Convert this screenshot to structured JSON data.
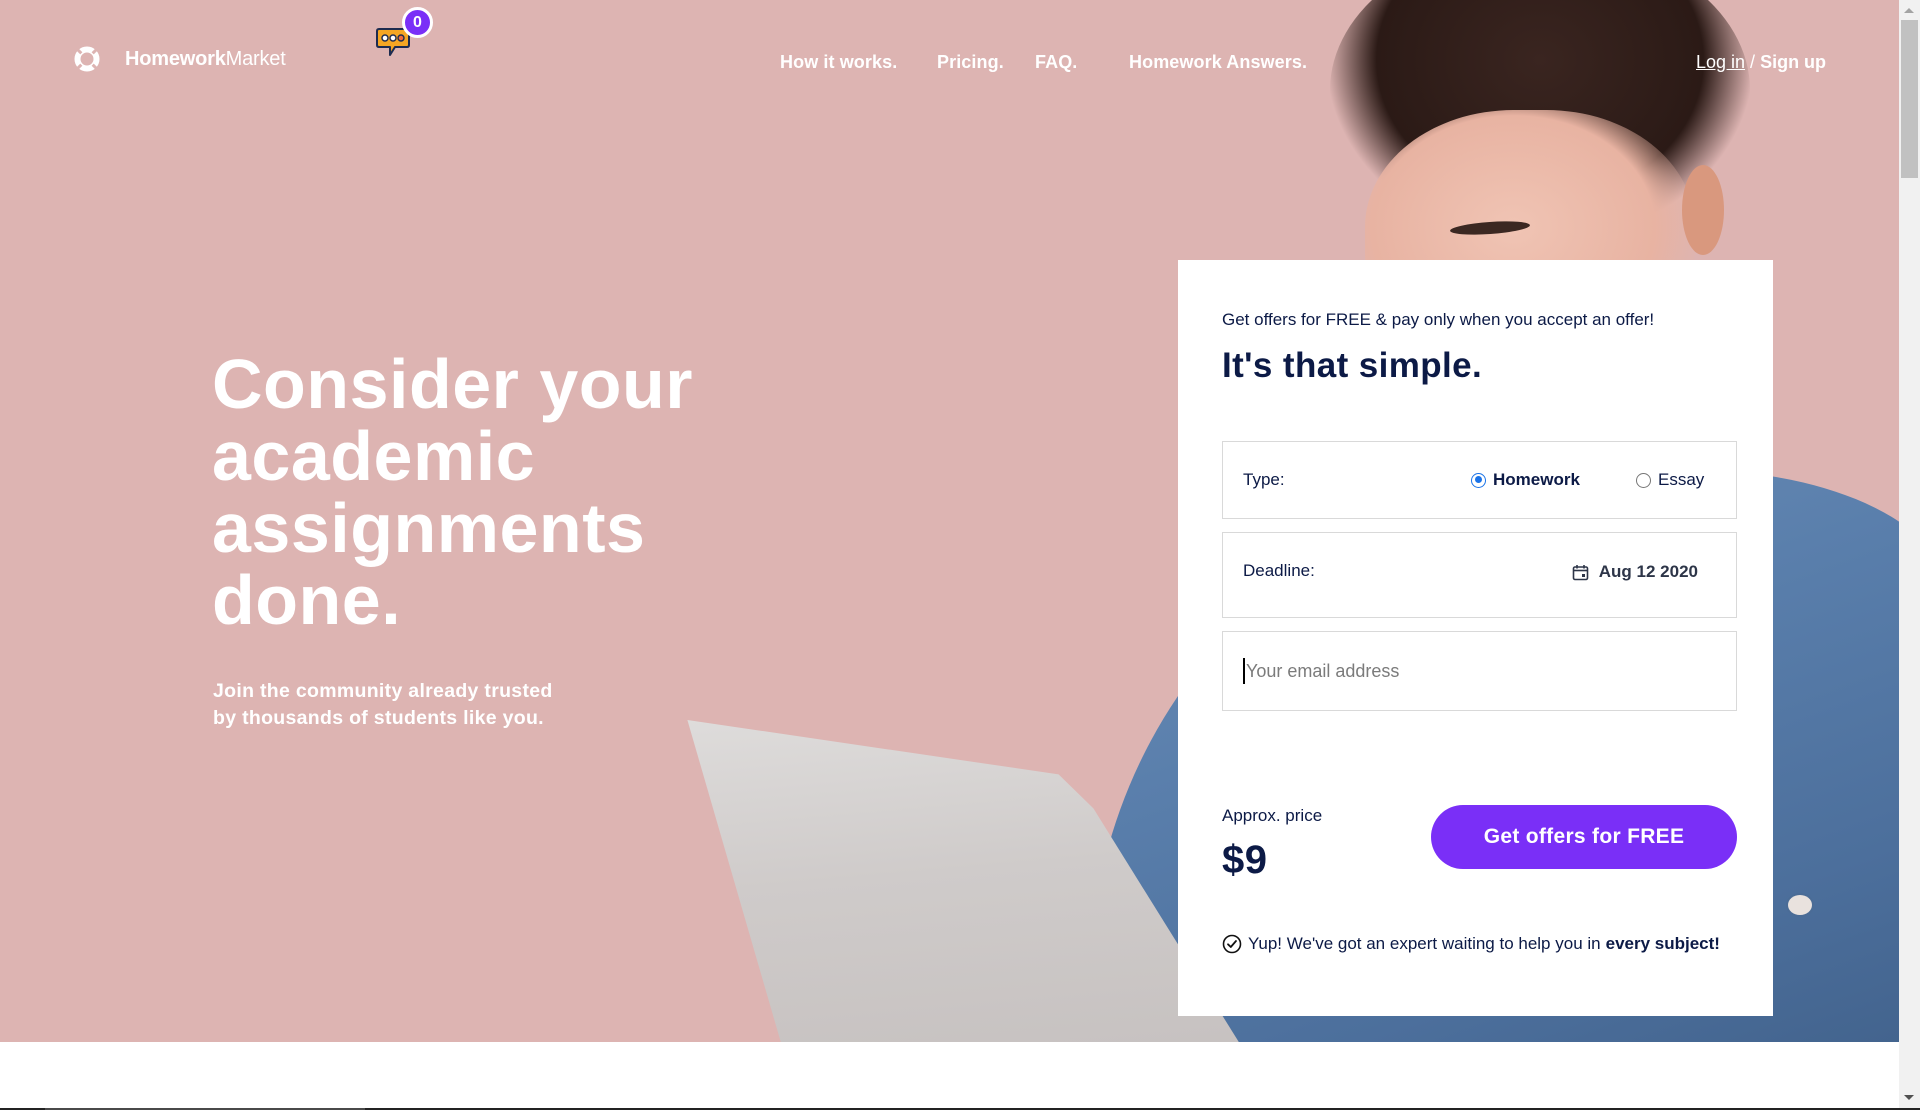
{
  "brand": {
    "name_bold": "Homework",
    "name_regular": "Market",
    "logo_icon": "ring-logo-icon"
  },
  "chat": {
    "icon": "chat-bubble-icon",
    "badge_count": "0"
  },
  "nav": {
    "items": [
      {
        "label": "How it works."
      },
      {
        "label": "Pricing."
      },
      {
        "label": "FAQ."
      },
      {
        "label": "Homework Answers."
      }
    ],
    "login_label": "Log in",
    "separator": " / ",
    "signup_label": "Sign up"
  },
  "hero": {
    "headline_lines": [
      "Consider your",
      "academic",
      "assignments",
      "done."
    ],
    "subtext_lines": [
      "Join the community already trusted",
      "by thousands of students like you."
    ]
  },
  "form": {
    "lead": "Get offers for FREE & pay only when you accept an offer!",
    "title": "It's that simple.",
    "type": {
      "label": "Type:",
      "options": [
        {
          "label": "Homework",
          "selected": true
        },
        {
          "label": "Essay",
          "selected": false
        }
      ]
    },
    "deadline": {
      "label": "Deadline:",
      "value": "Aug 12 2020",
      "icon": "calendar-icon"
    },
    "email": {
      "value": "",
      "placeholder": "Your email address"
    },
    "price": {
      "label": "Approx. price",
      "value": "$9"
    },
    "cta_label": "Get offers for FREE",
    "assurance_text": "Yup! We've got an expert waiting to help you in",
    "assurance_bold": "every subject!"
  },
  "colors": {
    "hero_background": "#ddb4b2",
    "accent_purple": "#7a2ff7",
    "text_navy": "#0c1a46",
    "radio_blue": "#1a73e8",
    "chat_orange": "#f5a623"
  }
}
